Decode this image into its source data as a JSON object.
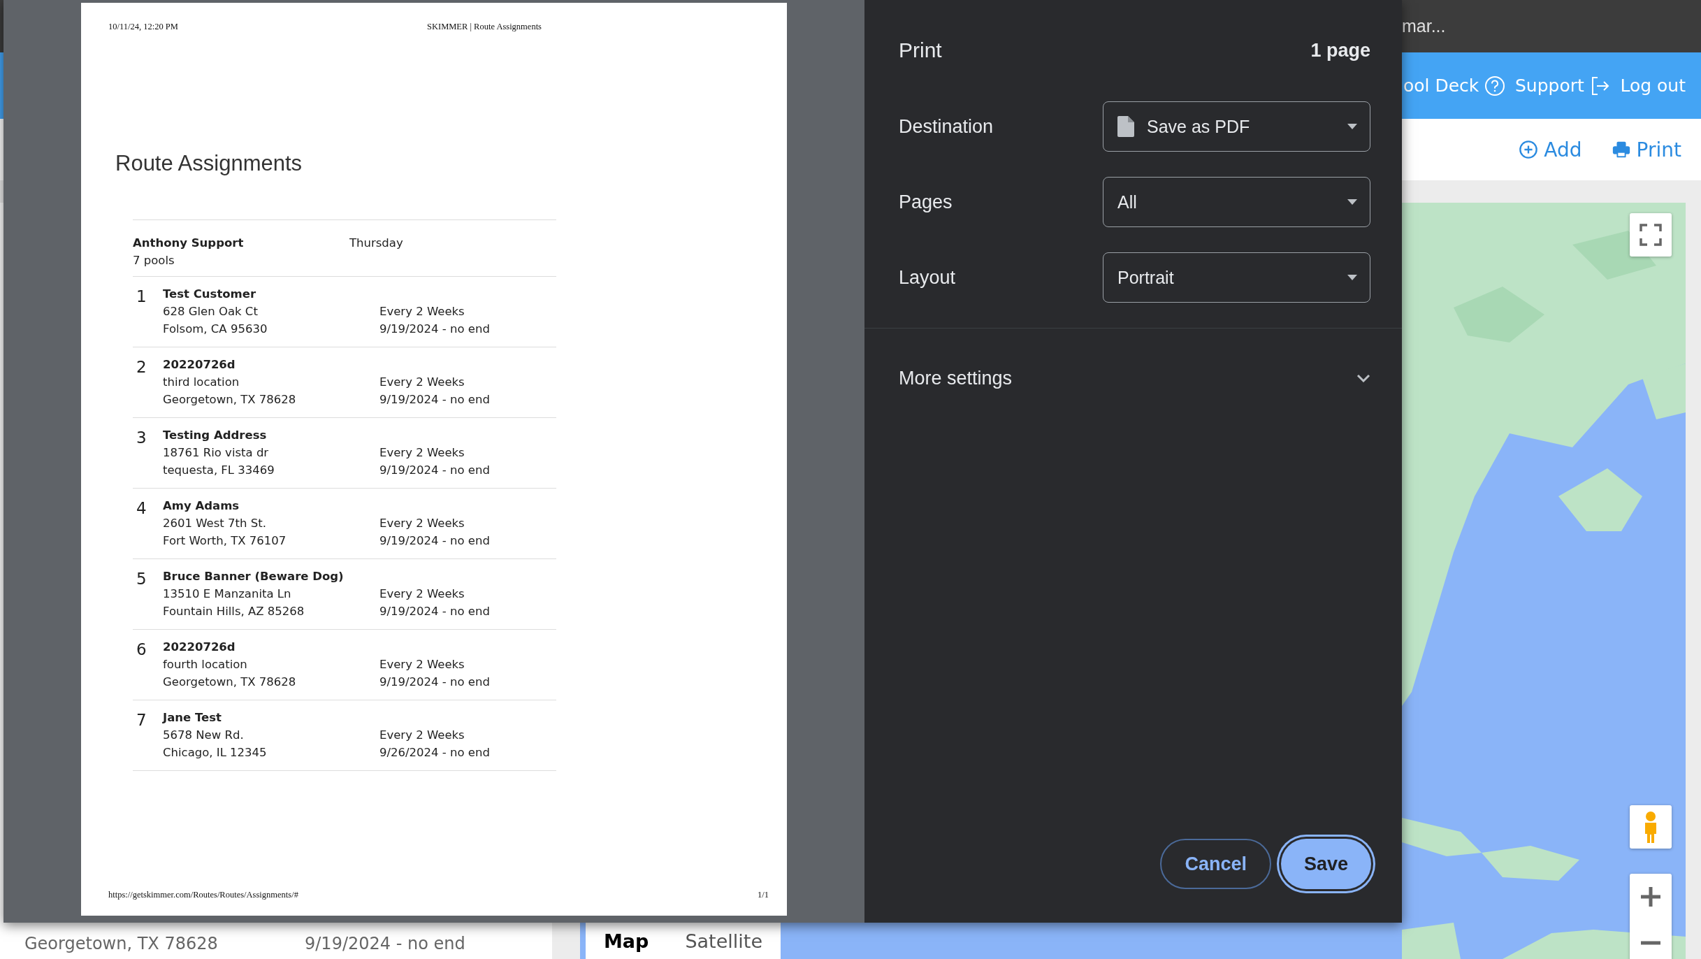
{
  "app": {
    "title": "mar...",
    "nav": [
      {
        "label": "ool Deck",
        "kind": "text"
      },
      {
        "label": "Support",
        "kind": "help"
      },
      {
        "label": "Log out",
        "kind": "logout"
      }
    ],
    "toolbar": [
      {
        "label": "Add",
        "kind": "add"
      },
      {
        "label": "Print",
        "kind": "print"
      }
    ],
    "list_row": {
      "address": "Georgetown, TX 78628",
      "schedule": "9/19/2024 - no end"
    },
    "map": {
      "kind": "picture",
      "map_types": [
        {
          "label": "Map",
          "selected": true
        },
        {
          "label": "Satellite",
          "selected": false
        }
      ]
    }
  },
  "print_dialog": {
    "preview": {
      "header_left": "10/11/24, 12:20 PM",
      "header_right": "SKIMMER | Route Assignments",
      "title": "Route Assignments",
      "groups": [
        {
          "name": "Anthony Support",
          "count": "7 pools",
          "day": "Thursday",
          "stops": [
            {
              "number": "1",
              "name": "Test Customer",
              "address": "628 Glen Oak Ct",
              "city": "Folsom, CA 95630",
              "frequency": "Every 2 Weeks",
              "dates": "9/19/2024 - no end"
            },
            {
              "number": "2",
              "name": "20220726d",
              "address": "third location",
              "city": "Georgetown, TX 78628",
              "frequency": "Every 2 Weeks",
              "dates": "9/19/2024 - no end"
            },
            {
              "number": "3",
              "name": "Testing Address",
              "address": "18761 Rio vista dr",
              "city": "tequesta, FL 33469",
              "frequency": "Every 2 Weeks",
              "dates": "9/19/2024 - no end"
            },
            {
              "number": "4",
              "name": "Amy Adams",
              "address": "2601 West 7th St.",
              "city": "Fort Worth, TX 76107",
              "frequency": "Every 2 Weeks",
              "dates": "9/19/2024 - no end"
            },
            {
              "number": "5",
              "name": "Bruce Banner (Beware Dog)",
              "address": "13510 E Manzanita Ln",
              "city": "Fountain Hills, AZ 85268",
              "frequency": "Every 2 Weeks",
              "dates": "9/19/2024 - no end"
            },
            {
              "number": "6",
              "name": "20220726d",
              "address": "fourth location",
              "city": "Georgetown, TX 78628",
              "frequency": "Every 2 Weeks",
              "dates": "9/19/2024 - no end"
            },
            {
              "number": "7",
              "name": "Jane Test",
              "address": "5678 New Rd.",
              "city": "Chicago, IL 12345",
              "frequency": "Every 2 Weeks",
              "dates": "9/26/2024 - no end"
            }
          ]
        }
      ],
      "footer_left": "https://getskimmer.com/Routes/Routes/Assignments/#",
      "footer_right": "1/1"
    },
    "title": "Print",
    "page_count": "1 page",
    "settings": [
      {
        "label": "Destination",
        "value": "Save as PDF",
        "kind": "destination"
      },
      {
        "label": "Pages",
        "value": "All",
        "kind": "select"
      },
      {
        "label": "Layout",
        "value": "Portrait",
        "kind": "select"
      }
    ],
    "more_settings": {
      "label": "More settings",
      "expanded": false
    },
    "buttons": [
      {
        "label": "Cancel",
        "kind": "secondary",
        "focused": false
      },
      {
        "label": "Save",
        "kind": "primary",
        "focused": true
      }
    ]
  }
}
